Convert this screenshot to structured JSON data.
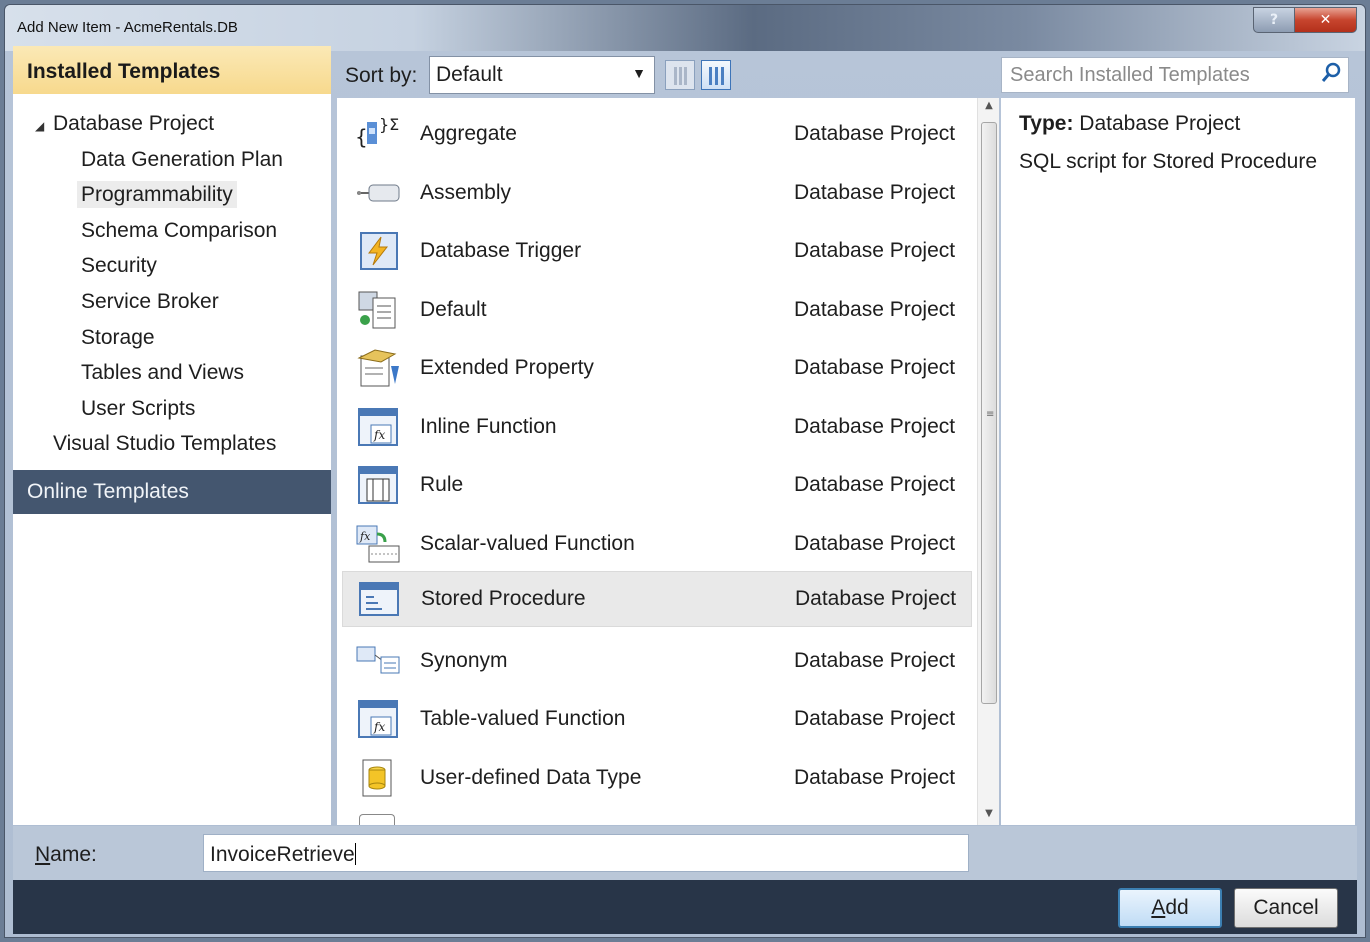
{
  "window": {
    "title": "Add New Item - AcmeRentals.DB",
    "help_glyph": "?",
    "close_glyph": "✕"
  },
  "left": {
    "header": "Installed Templates",
    "tree": [
      {
        "label": "Database Project",
        "level": 0,
        "expanded": true
      },
      {
        "label": "Data Generation Plan",
        "level": 1
      },
      {
        "label": "Programmability",
        "level": 1,
        "selected": true
      },
      {
        "label": "Schema Comparison",
        "level": 1
      },
      {
        "label": "Security",
        "level": 1
      },
      {
        "label": "Service Broker",
        "level": 1
      },
      {
        "label": "Storage",
        "level": 1
      },
      {
        "label": "Tables and Views",
        "level": 1
      },
      {
        "label": "User Scripts",
        "level": 1
      },
      {
        "label": "Visual Studio Templates",
        "level": 0
      }
    ],
    "online": "Online Templates"
  },
  "toolbar": {
    "sort_label": "Sort by:",
    "sort_value": "Default"
  },
  "templates": [
    {
      "name": "Aggregate",
      "category": "Database Project",
      "icon": "aggregate-icon"
    },
    {
      "name": "Assembly",
      "category": "Database Project",
      "icon": "assembly-icon"
    },
    {
      "name": "Database Trigger",
      "category": "Database Project",
      "icon": "trigger-icon"
    },
    {
      "name": "Default",
      "category": "Database Project",
      "icon": "default-icon"
    },
    {
      "name": "Extended Property",
      "category": "Database Project",
      "icon": "extended-property-icon"
    },
    {
      "name": "Inline Function",
      "category": "Database Project",
      "icon": "function-icon"
    },
    {
      "name": "Rule",
      "category": "Database Project",
      "icon": "rule-icon"
    },
    {
      "name": "Scalar-valued Function",
      "category": "Database Project",
      "icon": "scalar-function-icon"
    },
    {
      "name": "Stored Procedure",
      "category": "Database Project",
      "icon": "stored-procedure-icon",
      "selected": true
    },
    {
      "name": "Synonym",
      "category": "Database Project",
      "icon": "synonym-icon"
    },
    {
      "name": "Table-valued Function",
      "category": "Database Project",
      "icon": "function-icon"
    },
    {
      "name": "User-defined Data Type",
      "category": "Database Project",
      "icon": "data-type-icon"
    }
  ],
  "search": {
    "placeholder": "Search Installed Templates"
  },
  "details": {
    "type_label": "Type:",
    "type_value": "Database Project",
    "description": "SQL script for Stored Procedure"
  },
  "name_field": {
    "label_accel": "N",
    "label_rest": "ame:",
    "value": "InvoiceRetrieve"
  },
  "buttons": {
    "add_accel": "A",
    "add_rest": "dd",
    "cancel": "Cancel"
  }
}
